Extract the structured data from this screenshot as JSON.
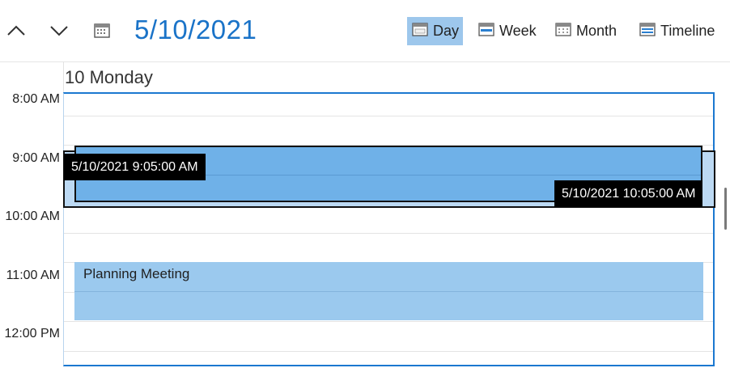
{
  "header": {
    "date_title": "5/10/2021",
    "views": [
      {
        "label": "Day",
        "icon": "calendar-day-icon",
        "active": true
      },
      {
        "label": "Week",
        "icon": "calendar-week-icon",
        "active": false
      },
      {
        "label": "Month",
        "icon": "calendar-month-icon",
        "active": false
      },
      {
        "label": "Timeline",
        "icon": "calendar-timeline-icon",
        "active": false
      }
    ]
  },
  "day": {
    "header": "10 Monday"
  },
  "time_slots": [
    "8:00 AM",
    "9:00 AM",
    "10:00 AM",
    "11:00 AM",
    "12:00 PM"
  ],
  "drag": {
    "start_tooltip": "5/10/2021 9:05:00 AM",
    "end_tooltip": "5/10/2021 10:05:00 AM"
  },
  "appointments": [
    {
      "title": "Planning Meeting"
    }
  ],
  "colors": {
    "accent": "#1a73c8",
    "active_view": "#9dc7ec",
    "appointment": "#9bc9ee",
    "dragged_appointment": "#6fb1e8",
    "tooltip": "#000000"
  }
}
